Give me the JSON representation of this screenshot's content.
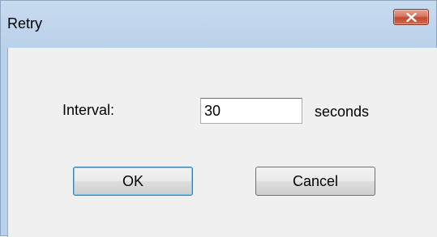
{
  "window": {
    "title": "Retry",
    "close_icon": "close-icon"
  },
  "form": {
    "interval_label": "Interval:",
    "interval_value": "30",
    "unit_label": "seconds"
  },
  "buttons": {
    "ok_label": "OK",
    "cancel_label": "Cancel"
  },
  "colors": {
    "title_bar": "#b9d1ea",
    "close_button": "#c24a2f",
    "client_area": "#f0f0f0"
  }
}
